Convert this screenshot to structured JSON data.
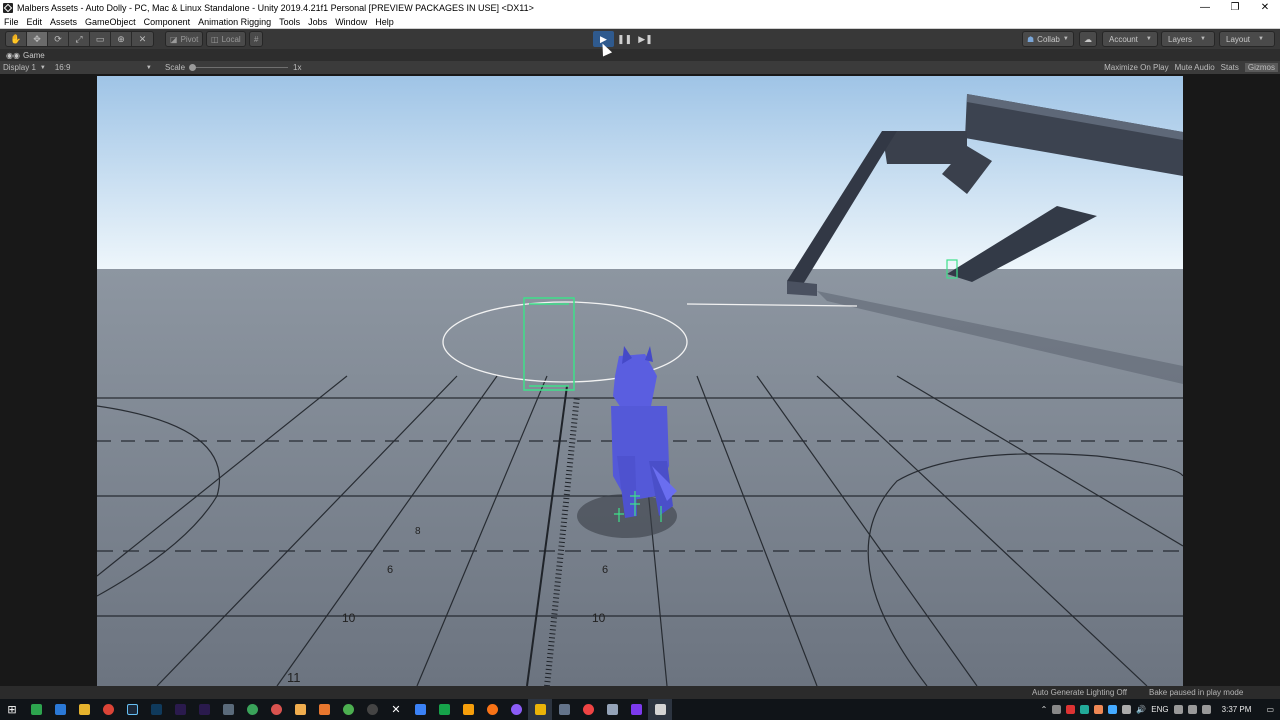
{
  "window": {
    "title": "Malbers Assets - Auto Dolly - PC, Mac & Linux Standalone - Unity 2019.4.21f1 Personal [PREVIEW PACKAGES IN USE] <DX11>",
    "minimize": "—",
    "maximize": "❐",
    "close": "✕"
  },
  "menu": [
    "File",
    "Edit",
    "Assets",
    "GameObject",
    "Component",
    "Animation Rigging",
    "Tools",
    "Jobs",
    "Window",
    "Help"
  ],
  "toolbar": {
    "tools": [
      "✋",
      "✥",
      "⟳",
      "⤢",
      "▭",
      "⊕",
      "✕"
    ],
    "pivot": "Pivot",
    "local": "Local",
    "grid_glyph": "#",
    "play": "▶",
    "pause": "❚❚",
    "step": "▶❚",
    "collab": "Collab",
    "account": "Account",
    "layers": "Layers",
    "layout": "Layout"
  },
  "game_tab": {
    "label": "Game"
  },
  "game_bar": {
    "display": "Display 1",
    "aspect": "16:9",
    "scale_label": "Scale",
    "scale_value": "1x",
    "maximize_on_play": "Maximize On Play",
    "mute_audio": "Mute Audio",
    "stats": "Stats",
    "gizmos": "Gizmos"
  },
  "scene_labels": {
    "l8": "8",
    "l6a": "6",
    "l6b": "6",
    "l10a": "10",
    "l10b": "10",
    "l11": "11"
  },
  "status": {
    "lighting": "Auto Generate Lighting Off",
    "bake": "Bake paused in play mode"
  },
  "taskbar": {
    "lang": "ENG",
    "time": "3:37 PM"
  },
  "colors": {
    "sky_top": "#9fc4e6",
    "sky_bottom": "#eef6fb",
    "ground": "#7a8490",
    "character": "#5a5ee0",
    "collider": "#3ee08a",
    "structure": "#3c4350",
    "play_active": "#2f5a8e"
  }
}
